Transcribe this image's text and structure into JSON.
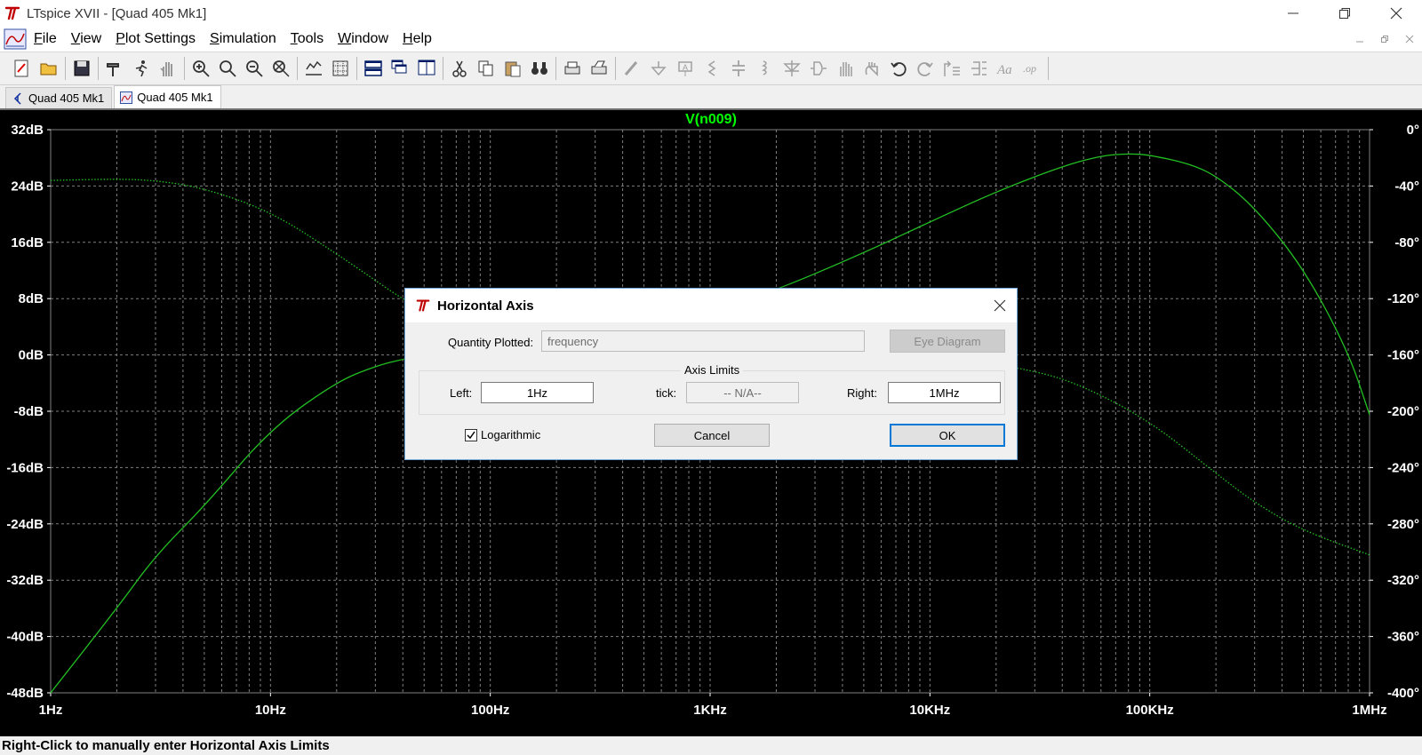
{
  "window": {
    "title": "LTspice XVII - [Quad 405 Mk1]"
  },
  "menu": [
    "File",
    "View",
    "Plot Settings",
    "Simulation",
    "Tools",
    "Window",
    "Help"
  ],
  "tabs": [
    {
      "label": "Quad 405 Mk1",
      "kind": "schematic"
    },
    {
      "label": "Quad 405 Mk1",
      "kind": "waveform"
    }
  ],
  "plot": {
    "trace_label": "V(n009)",
    "y_left_ticks": [
      "32dB",
      "24dB",
      "16dB",
      "8dB",
      "0dB",
      "-8dB",
      "-16dB",
      "-24dB",
      "-32dB",
      "-40dB",
      "-48dB"
    ],
    "y_right_ticks": [
      "0°",
      "-40°",
      "-80°",
      "-120°",
      "-160°",
      "-200°",
      "-240°",
      "-280°",
      "-320°",
      "-360°",
      "-400°"
    ],
    "x_ticks": [
      "1Hz",
      "10Hz",
      "100Hz",
      "1KHz",
      "10KHz",
      "100KHz",
      "1MHz"
    ]
  },
  "chart_data": {
    "type": "line",
    "title": "V(n009)",
    "x_scale": "log",
    "x_unit": "Hz",
    "xlim": [
      1,
      1000000
    ],
    "ylim_left": [
      -48,
      32
    ],
    "ylim_right": [
      -400,
      0
    ],
    "grid": true,
    "series": [
      {
        "axis": "left",
        "style": "solid",
        "x": [
          1,
          2,
          3,
          5,
          10,
          20,
          30,
          40,
          60,
          100,
          200,
          500,
          1000,
          2000,
          5000,
          10000,
          20000,
          40000,
          60000,
          80000,
          100000,
          150000,
          200000,
          300000,
          500000,
          800000,
          1000000
        ],
        "y": [
          -48,
          -36,
          -28.5,
          -21.5,
          -10.5,
          -3.8,
          -1.6,
          -0.6,
          0.5,
          1.3,
          2.4,
          4.4,
          6.2,
          9.2,
          14.5,
          18.9,
          23.2,
          26.8,
          28.3,
          28.6,
          28.4,
          27.2,
          25.5,
          21,
          12.4,
          0.5,
          -8.5
        ]
      },
      {
        "axis": "right",
        "style": "dotted",
        "x": [
          1,
          2,
          3,
          5,
          10,
          20,
          50,
          100,
          300,
          1000,
          3000,
          10000,
          30000,
          50000,
          100000,
          200000,
          300000,
          500000,
          1000000
        ],
        "y": [
          -36,
          -35,
          -36,
          -41.5,
          -58,
          -88,
          -131,
          -151,
          -157,
          -157,
          -157,
          -159,
          -171,
          -182,
          -207,
          -244,
          -265,
          -285,
          -302
        ]
      }
    ]
  },
  "dialog": {
    "title": "Horizontal Axis",
    "quantity_label": "Quantity Plotted:",
    "quantity_value": "frequency",
    "eye_diagram_label": "Eye Diagram",
    "group_label": "Axis Limits",
    "left_label": "Left:",
    "left_value": "1Hz",
    "tick_label": "tick:",
    "tick_value": "-- N/A--",
    "right_label": "Right:",
    "right_value": "1MHz",
    "logarithmic_label": "Logarithmic",
    "logarithmic_checked": true,
    "cancel_label": "Cancel",
    "ok_label": "OK"
  },
  "status": {
    "text": "Right-Click to manually enter Horizontal Axis Limits"
  }
}
